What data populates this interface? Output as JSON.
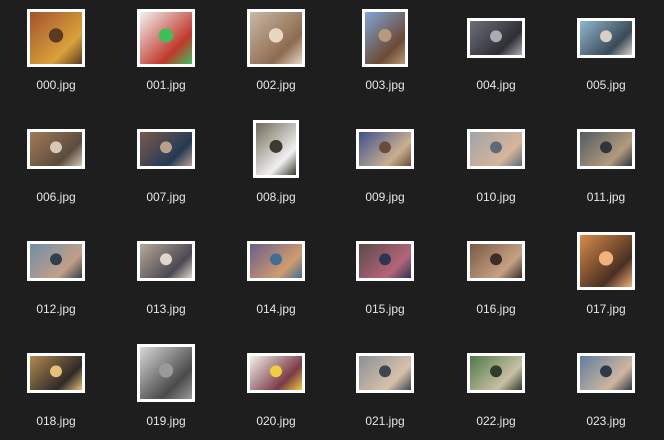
{
  "files": [
    {
      "name": "000.jpg",
      "orientation": "portrait-square",
      "tone": [
        "#a3522f",
        "#d9a23a",
        "#5b3a22"
      ]
    },
    {
      "name": "001.jpg",
      "orientation": "square",
      "tone": [
        "#f2f2f2",
        "#c0392b",
        "#3fbf5a"
      ]
    },
    {
      "name": "002.jpg",
      "orientation": "square",
      "tone": [
        "#c9b8a5",
        "#8d6b4f",
        "#e7d8c6"
      ]
    },
    {
      "name": "003.jpg",
      "orientation": "portrait",
      "tone": [
        "#7fa6d9",
        "#6b4a33",
        "#b79a7a"
      ]
    },
    {
      "name": "004.jpg",
      "orientation": "landscape",
      "tone": [
        "#6d7078",
        "#2d2f35",
        "#a9abb1"
      ]
    },
    {
      "name": "005.jpg",
      "orientation": "landscape",
      "tone": [
        "#8fb7cf",
        "#3b4a57",
        "#d6d0c7"
      ]
    },
    {
      "name": "006.jpg",
      "orientation": "landscape",
      "tone": [
        "#a37b58",
        "#5a4b3d",
        "#d7c7b3"
      ]
    },
    {
      "name": "007.jpg",
      "orientation": "landscape",
      "tone": [
        "#7b5a4a",
        "#243a57",
        "#b9a08a"
      ]
    },
    {
      "name": "008.jpg",
      "orientation": "portrait",
      "tone": [
        "#6f6a58",
        "#f0f0f0",
        "#3b3a33"
      ]
    },
    {
      "name": "009.jpg",
      "orientation": "landscape",
      "tone": [
        "#3f4f8f",
        "#c8b090",
        "#6b4b3a"
      ]
    },
    {
      "name": "010.jpg",
      "orientation": "landscape",
      "tone": [
        "#a0a4a8",
        "#d7b59a",
        "#5e6b77"
      ]
    },
    {
      "name": "011.jpg",
      "orientation": "landscape",
      "tone": [
        "#4f5b61",
        "#b39b7e",
        "#2f353a"
      ]
    },
    {
      "name": "012.jpg",
      "orientation": "landscape",
      "tone": [
        "#6e8fa8",
        "#c49f88",
        "#30404d"
      ]
    },
    {
      "name": "013.jpg",
      "orientation": "landscape",
      "tone": [
        "#b8a898",
        "#4a4a52",
        "#e0d6cc"
      ]
    },
    {
      "name": "014.jpg",
      "orientation": "landscape",
      "tone": [
        "#6a5e8a",
        "#d09c6e",
        "#3f6e96"
      ]
    },
    {
      "name": "015.jpg",
      "orientation": "landscape",
      "tone": [
        "#5a4a4a",
        "#b5657a",
        "#2f3550"
      ]
    },
    {
      "name": "016.jpg",
      "orientation": "landscape",
      "tone": [
        "#7a5a44",
        "#c6a184",
        "#3b2e26"
      ]
    },
    {
      "name": "017.jpg",
      "orientation": "square",
      "tone": [
        "#d98b4a",
        "#4a2f22",
        "#f0b27a"
      ]
    },
    {
      "name": "018.jpg",
      "orientation": "landscape",
      "tone": [
        "#b58a50",
        "#2e2a28",
        "#e6c07a"
      ]
    },
    {
      "name": "019.jpg",
      "orientation": "square",
      "tone": [
        "#d8d8d8",
        "#4a4a4a",
        "#9a9a9a"
      ]
    },
    {
      "name": "020.jpg",
      "orientation": "landscape",
      "tone": [
        "#f4f1ea",
        "#7a3a46",
        "#f2cc3a"
      ]
    },
    {
      "name": "021.jpg",
      "orientation": "landscape",
      "tone": [
        "#8a8f96",
        "#d7c2aa",
        "#3f464f"
      ]
    },
    {
      "name": "022.jpg",
      "orientation": "landscape",
      "tone": [
        "#4f7a47",
        "#c8c0a5",
        "#2f3d2a"
      ]
    },
    {
      "name": "023.jpg",
      "orientation": "landscape",
      "tone": [
        "#5e7f9e",
        "#d0b59f",
        "#2d3a4a"
      ]
    }
  ]
}
